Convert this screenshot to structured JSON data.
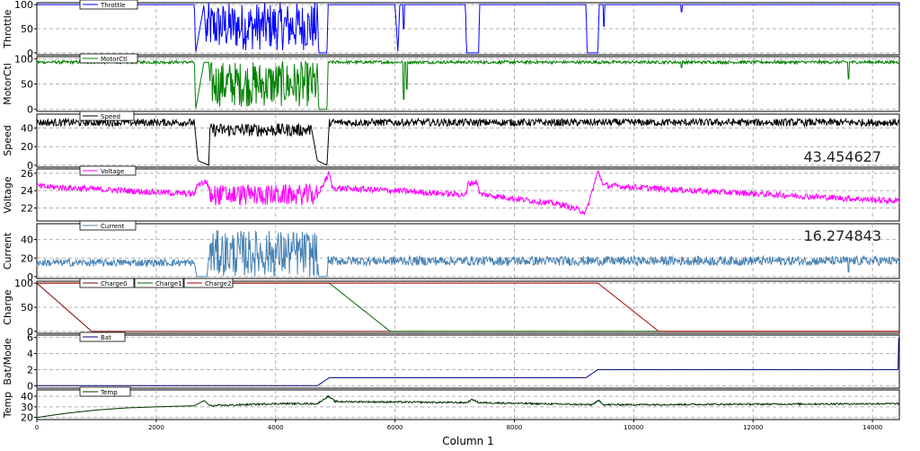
{
  "chart_data": {
    "type": "line",
    "xlabel": "Column 1",
    "xlim": [
      0,
      14450
    ],
    "x_ticks": [
      0,
      2000,
      4000,
      6000,
      8000,
      10000,
      12000,
      14000
    ],
    "x_tick_labels": [
      "0",
      "2000",
      "4000",
      "6000",
      "8000",
      "10000",
      "12000",
      "14000"
    ],
    "panels": [
      {
        "ylabel": "Throttle",
        "ylim": [
          -4,
          104
        ],
        "y_ticks": [
          0,
          50,
          100
        ],
        "y_tick_labels": [
          "0",
          "50",
          "100"
        ],
        "series": [
          {
            "name": "Throttle",
            "color": "#0000ff",
            "points": [
              [
                0,
                100
              ],
              [
                2640,
                100
              ],
              [
                2660,
                0
              ],
              [
                2800,
                100
              ],
              [
                2850,
                0
              ],
              [
                2900,
                100
              ],
              [
                4700,
                100
              ],
              [
                4720,
                0
              ],
              [
                4860,
                0
              ],
              [
                4880,
                100
              ],
              [
                6000,
                100
              ],
              [
                6050,
                0
              ],
              [
                6080,
                100
              ],
              [
                7180,
                100
              ],
              [
                7200,
                0
              ],
              [
                7400,
                0
              ],
              [
                7420,
                100
              ],
              [
                9200,
                100
              ],
              [
                9220,
                0
              ],
              [
                9400,
                0
              ],
              [
                9420,
                100
              ],
              [
                14450,
                100
              ]
            ],
            "noise": [
              [
                2840,
                4700,
                55,
                50
              ]
            ],
            "spikes": [
              [
                6150,
                50
              ],
              [
                10800,
                85
              ],
              [
                9500,
                55
              ]
            ]
          }
        ]
      },
      {
        "ylabel": "MotorCtl",
        "ylim": [
          -4,
          104
        ],
        "y_ticks": [
          0,
          50,
          100
        ],
        "y_tick_labels": [
          "0",
          "50",
          "100"
        ],
        "series": [
          {
            "name": "MotorCtl",
            "color": "#008000",
            "points": [
              [
                0,
                93
              ],
              [
                2640,
                93
              ],
              [
                2660,
                0
              ],
              [
                2800,
                93
              ],
              [
                2880,
                93
              ],
              [
                4700,
                93
              ],
              [
                4720,
                0
              ],
              [
                4860,
                0
              ],
              [
                4880,
                93
              ],
              [
                6000,
                93
              ],
              [
                6050,
                0
              ],
              [
                6080,
                93
              ],
              [
                7180,
                93
              ],
              [
                7200,
                0
              ],
              [
                7400,
                0
              ],
              [
                7420,
                93
              ],
              [
                9200,
                93
              ],
              [
                9220,
                0
              ],
              [
                9400,
                0
              ],
              [
                9420,
                93
              ],
              [
                14450,
                93
              ]
            ],
            "noise": [
              [
                0,
                2640,
                93,
                3
              ],
              [
                2880,
                4700,
                50,
                45
              ],
              [
                4880,
                14450,
                93,
                3
              ]
            ],
            "spikes": [
              [
                6150,
                20
              ],
              [
                6200,
                40
              ],
              [
                10800,
                82
              ],
              [
                13600,
                60
              ]
            ]
          }
        ]
      },
      {
        "ylabel": "Speed",
        "ylim": [
          -2,
          55
        ],
        "y_ticks": [
          0,
          20,
          40
        ],
        "y_tick_labels": [
          "0",
          "20",
          "40"
        ],
        "readout": "43.454627",
        "series": [
          {
            "name": "Speed",
            "color": "#000000",
            "points": [
              [
                0,
                46
              ],
              [
                2640,
                46
              ],
              [
                2700,
                5
              ],
              [
                2880,
                0
              ],
              [
                2900,
                40
              ],
              [
                4600,
                40
              ],
              [
                4700,
                5
              ],
              [
                4860,
                0
              ],
              [
                4900,
                46
              ],
              [
                7150,
                46
              ],
              [
                7200,
                8
              ],
              [
                7350,
                8
              ],
              [
                7420,
                46
              ],
              [
                9200,
                46
              ],
              [
                9250,
                8
              ],
              [
                9380,
                2
              ],
              [
                9450,
                46
              ],
              [
                14450,
                46
              ]
            ],
            "noise": [
              [
                0,
                2640,
                46,
                4
              ],
              [
                2900,
                4600,
                38,
                7
              ],
              [
                4900,
                14450,
                46,
                4
              ]
            ],
            "spikes": []
          }
        ]
      },
      {
        "ylabel": "Voltage",
        "ylim": [
          20.5,
          26.5
        ],
        "y_ticks": [
          22,
          24,
          26
        ],
        "y_tick_labels": [
          "22",
          "24",
          "26"
        ],
        "series": [
          {
            "name": "Voltage",
            "color": "#ff00ff",
            "points": [
              [
                0,
                24.5
              ],
              [
                2640,
                23.6
              ],
              [
                2700,
                24.8
              ],
              [
                2850,
                25.0
              ],
              [
                2900,
                24.0
              ],
              [
                4700,
                23.5
              ],
              [
                4900,
                26.0
              ],
              [
                4950,
                24.3
              ],
              [
                6000,
                24.0
              ],
              [
                7200,
                23.5
              ],
              [
                7220,
                24.8
              ],
              [
                7380,
                25.0
              ],
              [
                7420,
                23.6
              ],
              [
                8800,
                22.4
              ],
              [
                9200,
                21.5
              ],
              [
                9400,
                26.2
              ],
              [
                9500,
                24.6
              ],
              [
                11000,
                24.0
              ],
              [
                14450,
                22.8
              ]
            ],
            "noise": [
              [
                0,
                14450,
                0,
                0.35
              ],
              [
                2900,
                4700,
                23.5,
                1.2
              ]
            ],
            "spikes": []
          }
        ]
      },
      {
        "ylabel": "Current",
        "ylim": [
          -2,
          57
        ],
        "y_ticks": [
          0,
          20,
          40
        ],
        "y_tick_labels": [
          "0",
          "20",
          "40"
        ],
        "readout": "16.274843",
        "series": [
          {
            "name": "Current",
            "color": "#4682b4",
            "points": [
              [
                0,
                15
              ],
              [
                2640,
                15
              ],
              [
                2680,
                0
              ],
              [
                2850,
                0
              ],
              [
                2880,
                20
              ],
              [
                4700,
                20
              ],
              [
                4720,
                0
              ],
              [
                4860,
                0
              ],
              [
                4880,
                16
              ],
              [
                6000,
                16
              ],
              [
                6050,
                2
              ],
              [
                6080,
                16
              ],
              [
                7180,
                16
              ],
              [
                7200,
                2
              ],
              [
                7400,
                2
              ],
              [
                7420,
                16
              ],
              [
                9200,
                16
              ],
              [
                9220,
                2
              ],
              [
                9400,
                2
              ],
              [
                9420,
                18
              ],
              [
                14450,
                18
              ]
            ],
            "noise": [
              [
                0,
                2640,
                15,
                4
              ],
              [
                2880,
                4700,
                25,
                25
              ],
              [
                4880,
                14450,
                17,
                5
              ]
            ],
            "spikes": [
              [
                13600,
                5
              ]
            ]
          }
        ]
      },
      {
        "ylabel": "Charge",
        "ylim": [
          -4,
          104
        ],
        "y_ticks": [
          0,
          50,
          100
        ],
        "y_tick_labels": [
          "0",
          "50",
          "100"
        ],
        "series": [
          {
            "name": "Charge0",
            "color": "#800000",
            "points": [
              [
                0,
                100
              ],
              [
                920,
                0
              ],
              [
                14450,
                0
              ]
            ],
            "noise": [],
            "spikes": []
          },
          {
            "name": "Charge1",
            "color": "#006400",
            "points": [
              [
                0,
                100
              ],
              [
                4900,
                100
              ],
              [
                5920,
                0
              ],
              [
                14450,
                0
              ]
            ],
            "noise": [],
            "spikes": []
          },
          {
            "name": "Charge2",
            "color": "#b00000",
            "points": [
              [
                0,
                100
              ],
              [
                9400,
                100
              ],
              [
                10420,
                0
              ],
              [
                14450,
                0
              ]
            ],
            "noise": [],
            "spikes": []
          }
        ]
      },
      {
        "ylabel": "Bat/Mode",
        "ylim": [
          -0.3,
          6.3
        ],
        "y_ticks": [
          0,
          2,
          4,
          6
        ],
        "y_tick_labels": [
          "0",
          "2",
          "4",
          "6"
        ],
        "series": [
          {
            "name": "Bat",
            "color": "#000080",
            "points": [
              [
                0,
                0
              ],
              [
                4700,
                0
              ],
              [
                4900,
                1
              ],
              [
                9200,
                1
              ],
              [
                9400,
                2
              ],
              [
                14430,
                2
              ],
              [
                14440,
                6
              ]
            ],
            "noise": [],
            "spikes": []
          }
        ]
      },
      {
        "ylabel": "Temp",
        "ylim": [
          18,
          46
        ],
        "y_ticks": [
          20,
          30,
          40
        ],
        "y_tick_labels": [
          "20",
          "30",
          "40"
        ],
        "series": [
          {
            "name": "Temp",
            "color": "#003300",
            "points": [
              [
                0,
                20
              ],
              [
                500,
                24
              ],
              [
                1000,
                27
              ],
              [
                1500,
                29
              ],
              [
                2000,
                30
              ],
              [
                2640,
                31
              ],
              [
                2800,
                36
              ],
              [
                2900,
                31
              ],
              [
                4000,
                33
              ],
              [
                4700,
                33
              ],
              [
                4880,
                40
              ],
              [
                5000,
                35
              ],
              [
                7200,
                34
              ],
              [
                7300,
                37
              ],
              [
                7400,
                34
              ],
              [
                9300,
                32
              ],
              [
                9420,
                36
              ],
              [
                9500,
                32
              ],
              [
                14450,
                33
              ]
            ],
            "noise": [
              [
                2900,
                14450,
                0,
                0.8
              ]
            ],
            "spikes": []
          }
        ]
      }
    ]
  }
}
